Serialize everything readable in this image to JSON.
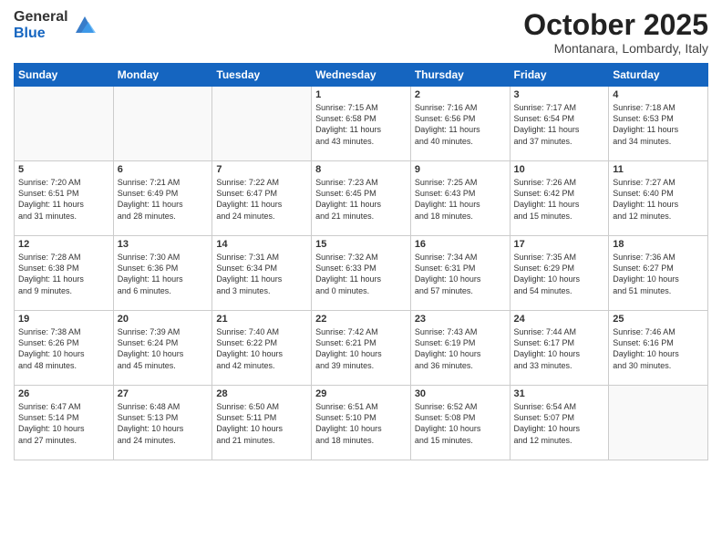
{
  "logo": {
    "general": "General",
    "blue": "Blue"
  },
  "title": "October 2025",
  "subtitle": "Montanara, Lombardy, Italy",
  "days_header": [
    "Sunday",
    "Monday",
    "Tuesday",
    "Wednesday",
    "Thursday",
    "Friday",
    "Saturday"
  ],
  "weeks": [
    [
      {
        "day": "",
        "info": ""
      },
      {
        "day": "",
        "info": ""
      },
      {
        "day": "",
        "info": ""
      },
      {
        "day": "1",
        "info": "Sunrise: 7:15 AM\nSunset: 6:58 PM\nDaylight: 11 hours\nand 43 minutes."
      },
      {
        "day": "2",
        "info": "Sunrise: 7:16 AM\nSunset: 6:56 PM\nDaylight: 11 hours\nand 40 minutes."
      },
      {
        "day": "3",
        "info": "Sunrise: 7:17 AM\nSunset: 6:54 PM\nDaylight: 11 hours\nand 37 minutes."
      },
      {
        "day": "4",
        "info": "Sunrise: 7:18 AM\nSunset: 6:53 PM\nDaylight: 11 hours\nand 34 minutes."
      }
    ],
    [
      {
        "day": "5",
        "info": "Sunrise: 7:20 AM\nSunset: 6:51 PM\nDaylight: 11 hours\nand 31 minutes."
      },
      {
        "day": "6",
        "info": "Sunrise: 7:21 AM\nSunset: 6:49 PM\nDaylight: 11 hours\nand 28 minutes."
      },
      {
        "day": "7",
        "info": "Sunrise: 7:22 AM\nSunset: 6:47 PM\nDaylight: 11 hours\nand 24 minutes."
      },
      {
        "day": "8",
        "info": "Sunrise: 7:23 AM\nSunset: 6:45 PM\nDaylight: 11 hours\nand 21 minutes."
      },
      {
        "day": "9",
        "info": "Sunrise: 7:25 AM\nSunset: 6:43 PM\nDaylight: 11 hours\nand 18 minutes."
      },
      {
        "day": "10",
        "info": "Sunrise: 7:26 AM\nSunset: 6:42 PM\nDaylight: 11 hours\nand 15 minutes."
      },
      {
        "day": "11",
        "info": "Sunrise: 7:27 AM\nSunset: 6:40 PM\nDaylight: 11 hours\nand 12 minutes."
      }
    ],
    [
      {
        "day": "12",
        "info": "Sunrise: 7:28 AM\nSunset: 6:38 PM\nDaylight: 11 hours\nand 9 minutes."
      },
      {
        "day": "13",
        "info": "Sunrise: 7:30 AM\nSunset: 6:36 PM\nDaylight: 11 hours\nand 6 minutes."
      },
      {
        "day": "14",
        "info": "Sunrise: 7:31 AM\nSunset: 6:34 PM\nDaylight: 11 hours\nand 3 minutes."
      },
      {
        "day": "15",
        "info": "Sunrise: 7:32 AM\nSunset: 6:33 PM\nDaylight: 11 hours\nand 0 minutes."
      },
      {
        "day": "16",
        "info": "Sunrise: 7:34 AM\nSunset: 6:31 PM\nDaylight: 10 hours\nand 57 minutes."
      },
      {
        "day": "17",
        "info": "Sunrise: 7:35 AM\nSunset: 6:29 PM\nDaylight: 10 hours\nand 54 minutes."
      },
      {
        "day": "18",
        "info": "Sunrise: 7:36 AM\nSunset: 6:27 PM\nDaylight: 10 hours\nand 51 minutes."
      }
    ],
    [
      {
        "day": "19",
        "info": "Sunrise: 7:38 AM\nSunset: 6:26 PM\nDaylight: 10 hours\nand 48 minutes."
      },
      {
        "day": "20",
        "info": "Sunrise: 7:39 AM\nSunset: 6:24 PM\nDaylight: 10 hours\nand 45 minutes."
      },
      {
        "day": "21",
        "info": "Sunrise: 7:40 AM\nSunset: 6:22 PM\nDaylight: 10 hours\nand 42 minutes."
      },
      {
        "day": "22",
        "info": "Sunrise: 7:42 AM\nSunset: 6:21 PM\nDaylight: 10 hours\nand 39 minutes."
      },
      {
        "day": "23",
        "info": "Sunrise: 7:43 AM\nSunset: 6:19 PM\nDaylight: 10 hours\nand 36 minutes."
      },
      {
        "day": "24",
        "info": "Sunrise: 7:44 AM\nSunset: 6:17 PM\nDaylight: 10 hours\nand 33 minutes."
      },
      {
        "day": "25",
        "info": "Sunrise: 7:46 AM\nSunset: 6:16 PM\nDaylight: 10 hours\nand 30 minutes."
      }
    ],
    [
      {
        "day": "26",
        "info": "Sunrise: 6:47 AM\nSunset: 5:14 PM\nDaylight: 10 hours\nand 27 minutes."
      },
      {
        "day": "27",
        "info": "Sunrise: 6:48 AM\nSunset: 5:13 PM\nDaylight: 10 hours\nand 24 minutes."
      },
      {
        "day": "28",
        "info": "Sunrise: 6:50 AM\nSunset: 5:11 PM\nDaylight: 10 hours\nand 21 minutes."
      },
      {
        "day": "29",
        "info": "Sunrise: 6:51 AM\nSunset: 5:10 PM\nDaylight: 10 hours\nand 18 minutes."
      },
      {
        "day": "30",
        "info": "Sunrise: 6:52 AM\nSunset: 5:08 PM\nDaylight: 10 hours\nand 15 minutes."
      },
      {
        "day": "31",
        "info": "Sunrise: 6:54 AM\nSunset: 5:07 PM\nDaylight: 10 hours\nand 12 minutes."
      },
      {
        "day": "",
        "info": ""
      }
    ]
  ]
}
